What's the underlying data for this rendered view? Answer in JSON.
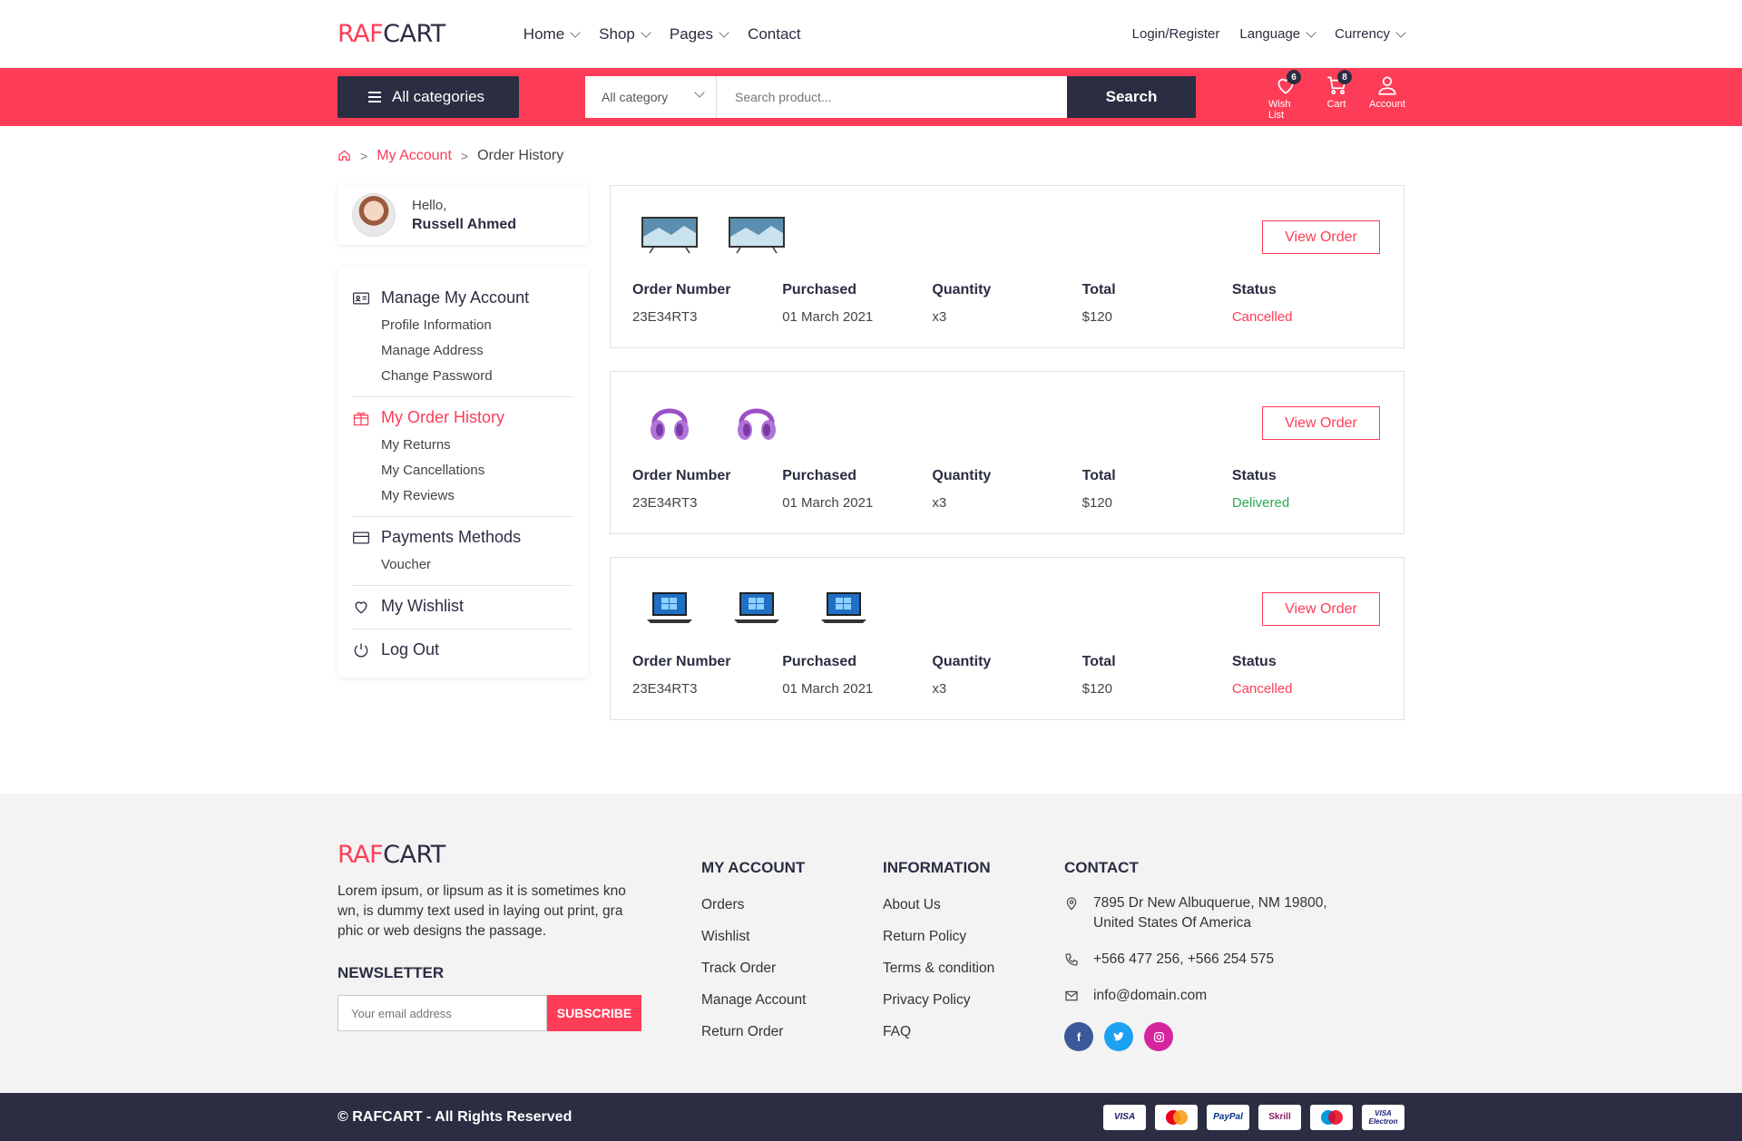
{
  "brand": {
    "part1": "RAF",
    "part2": "CART"
  },
  "nav": {
    "items": [
      {
        "label": "Home",
        "dropdown": true
      },
      {
        "label": "Shop",
        "dropdown": true
      },
      {
        "label": "Pages",
        "dropdown": true
      },
      {
        "label": "Contact",
        "dropdown": false
      }
    ],
    "login": "Login/Register",
    "language": "Language",
    "currency": "Currency"
  },
  "searchbar": {
    "all_categories": "All categories",
    "category_select": "All category",
    "placeholder": "Search product...",
    "button": "Search",
    "wishlist_label": "Wish List",
    "wishlist_count": "6",
    "cart_label": "Cart",
    "cart_count": "8",
    "account_label": "Account"
  },
  "breadcrumb": {
    "parent": "My Account",
    "current": "Order History"
  },
  "profile": {
    "greeting": "Hello,",
    "name": "Russell Ahmed"
  },
  "sidebar": {
    "manage": {
      "title": "Manage My Account",
      "items": [
        "Profile Information",
        "Manage Address",
        "Change Password"
      ]
    },
    "orders": {
      "title": "My Order History",
      "items": [
        "My Returns",
        "My Cancellations",
        "My Reviews"
      ]
    },
    "payments": {
      "title": "Payments Methods",
      "items": [
        "Voucher"
      ]
    },
    "wishlist": {
      "title": "My Wishlist"
    },
    "logout": {
      "title": "Log Out"
    }
  },
  "order_labels": {
    "number": "Order Number",
    "purchased": "Purchased",
    "quantity": "Quantity",
    "total": "Total",
    "status": "Status",
    "view": "View Order"
  },
  "orders": [
    {
      "number": "23E34RT3",
      "purchased": "01 March 2021",
      "quantity": "x3",
      "total": "$120",
      "status": "Cancelled",
      "product": "tv-icon"
    },
    {
      "number": "23E34RT3",
      "purchased": "01 March 2021",
      "quantity": "x3",
      "total": "$120",
      "status": "Delivered",
      "product": "headphones-icon"
    },
    {
      "number": "23E34RT3",
      "purchased": "01 March 2021",
      "quantity": "x3",
      "total": "$120",
      "status": "Cancelled",
      "product": "laptop-icon"
    }
  ],
  "footer": {
    "about": "Lorem ipsum, or lipsum as it is sometimes kno wn, is dummy text used in laying out print, gra phic or web designs the passage.",
    "newsletter_title": "NEWSLETTER",
    "newsletter_placeholder": "Your email address",
    "subscribe": "SUBSCRIBE",
    "my_account": {
      "title": "MY ACCOUNT",
      "links": [
        "Orders",
        "Wishlist",
        "Track Order",
        "Manage Account",
        "Return Order"
      ]
    },
    "information": {
      "title": "INFORMATION",
      "links": [
        "About Us",
        "Return Policy",
        "Terms & condition",
        "Privacy Policy",
        "FAQ"
      ]
    },
    "contact": {
      "title": "CONTACT",
      "address": "7895 Dr New Albuquerue, NM 19800, United States Of America",
      "phone": "+566 477 256, +566 254 575",
      "email": "info@domain.com"
    },
    "copyright": "© RAFCART - All Rights Reserved",
    "payments": [
      "VISA",
      "Mastercard",
      "PayPal",
      "Skrill",
      "Maestro",
      "VISA Electron"
    ]
  },
  "colors": {
    "accent": "#fd3d57",
    "dark": "#2b2d42",
    "delivered": "#2eaa4f"
  }
}
